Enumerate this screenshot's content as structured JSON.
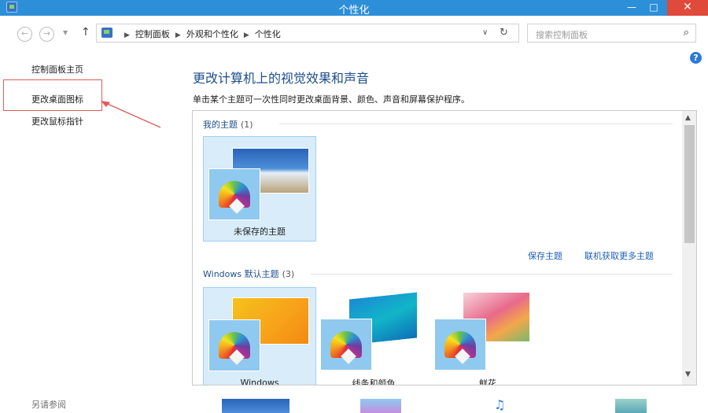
{
  "window": {
    "title": "个性化",
    "minimize": "—",
    "maximize": "□",
    "close": "✕"
  },
  "address_bar": {
    "breadcrumbs": [
      "控制面板",
      "外观和个性化",
      "个性化"
    ],
    "search_placeholder": "搜索控制面板"
  },
  "left_pane": {
    "links": [
      "控制面板主页",
      "更改桌面图标",
      "更改鼠标指针"
    ],
    "see_also": "另请参阅"
  },
  "main": {
    "heading": "更改计算机上的视觉效果和声音",
    "description": "单击某个主题可一次性同时更改桌面背景、颜色、声音和屏幕保护程序。",
    "my_themes": {
      "title": "我的主题",
      "count": "(1)"
    },
    "unsaved_theme_label": "未保存的主题",
    "save_theme_link": "保存主题",
    "online_themes_link": "联机获取更多主题",
    "windows_themes": {
      "title": "Windows 默认主题",
      "count": "(3)"
    },
    "default_themes": [
      "Windows",
      "线条和颜色",
      "鲜花"
    ]
  },
  "colors": {
    "titlebar": "#2d8fd8",
    "close_button": "#e04a3a",
    "link": "#1e5fb8",
    "selection": "#d8ecf9",
    "annotation": "#e05a5a"
  },
  "icons": [
    "app-icon",
    "back-arrow-icon",
    "forward-arrow-icon",
    "up-arrow-icon",
    "control-panel-icon",
    "refresh-icon",
    "search-icon",
    "help-icon",
    "color-palette-icon",
    "scroll-up-icon",
    "scroll-down-icon"
  ]
}
